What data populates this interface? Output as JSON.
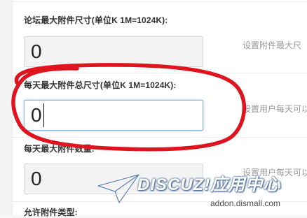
{
  "fields": [
    {
      "label": "论坛最大附件尺寸(单位K 1M=1024K):",
      "value": "0",
      "hint": "设置附件最大尺"
    },
    {
      "label": "每天最大附件总尺寸(单位K 1M=1024K):",
      "value": "0",
      "hint": "设置用户每天可以"
    },
    {
      "label": "每天最大附件数量:",
      "value": "0",
      "hint": "设置用户每天可以"
    },
    {
      "label": "允许附件类型:"
    }
  ],
  "watermark": {
    "logo": "DISCUZ!应用中心",
    "url": "addon.dismall.com"
  },
  "colors": {
    "annotation": "#e0141e",
    "focus_border": "#8fb1e6"
  }
}
